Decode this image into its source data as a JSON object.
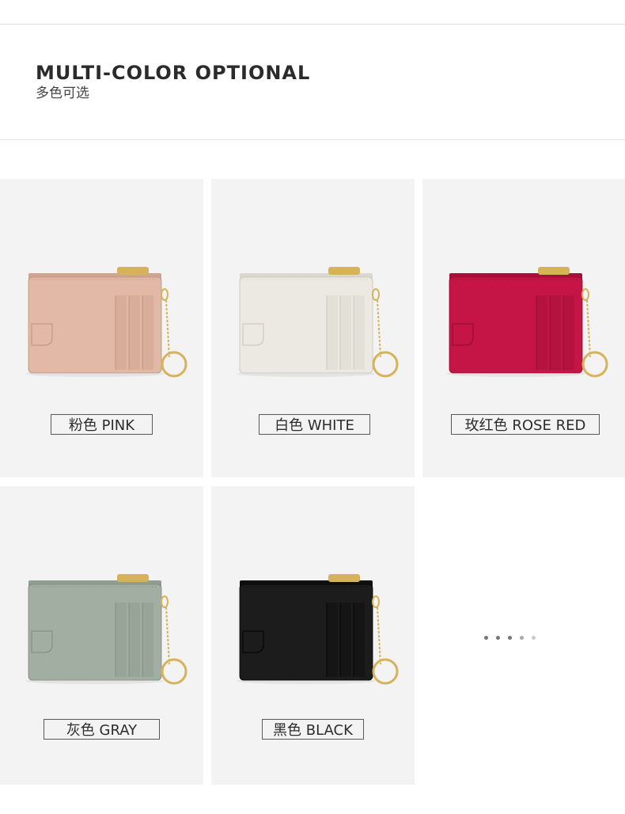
{
  "header": {
    "title": "MULTI-COLOR OPTIONAL",
    "subtitle": "多色可选"
  },
  "colors": [
    {
      "label": "粉色 PINK",
      "body": "#e2b9a6",
      "shade": "#cfa592",
      "edge": "#b8917f"
    },
    {
      "label": "白色 WHITE",
      "body": "#ece9e2",
      "shade": "#dcd8cf",
      "edge": "#c8c3b8"
    },
    {
      "label": "玫红色 ROSE RED",
      "body": "#c41546",
      "shade": "#a8103a",
      "edge": "#8c0c30"
    },
    {
      "label": "灰色 GRAY",
      "body": "#a3aea3",
      "shade": "#929d92",
      "edge": "#7e897e"
    },
    {
      "label": "黑色 BLACK",
      "body": "#1c1c1c",
      "shade": "#101010",
      "edge": "#000000"
    }
  ],
  "carousel": {
    "dots": 5,
    "active": 1
  },
  "hardware_color": "#d6b25a"
}
